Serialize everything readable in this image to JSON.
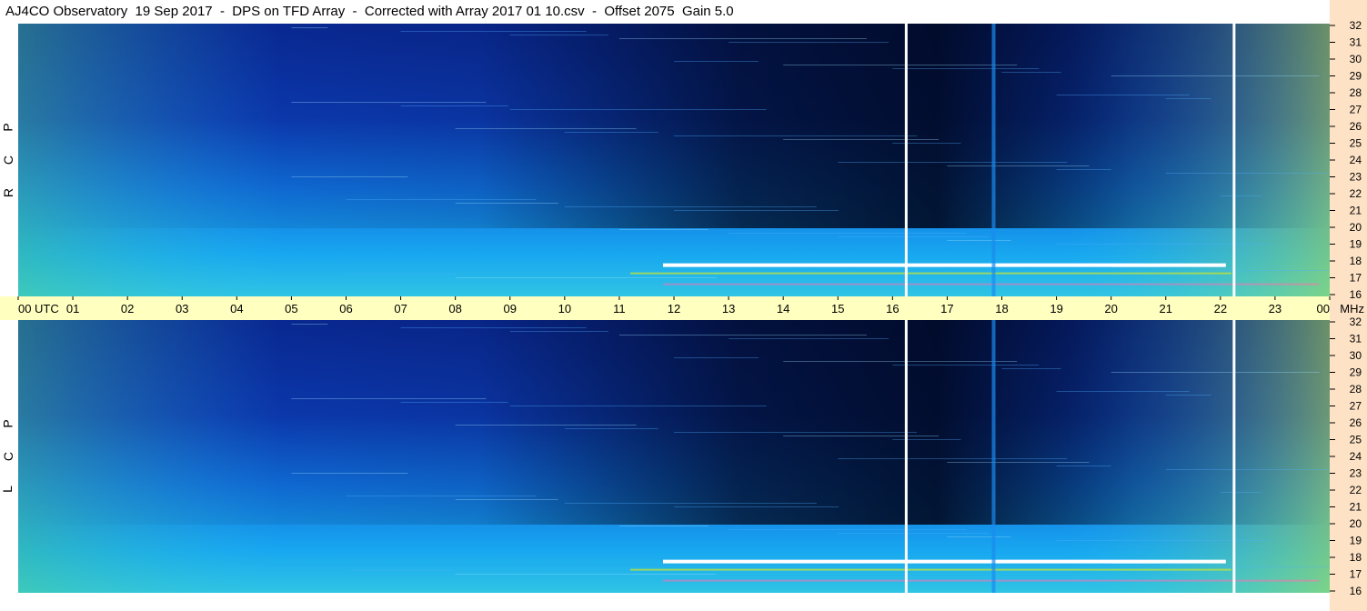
{
  "title": "AJ4CO Observatory  19 Sep 2017  -  DPS on TFD Array  -  Corrected with Array 2017 01 10.csv  -  Offset 2075  Gain 5.0",
  "panels": [
    {
      "polarization_letters": [
        "R",
        "C",
        "P"
      ]
    },
    {
      "polarization_letters": [
        "L",
        "C",
        "P"
      ]
    }
  ],
  "time_axis": {
    "unit_label": "UTC",
    "freq_unit_label": "MHz",
    "ticks": [
      "00",
      "01",
      "02",
      "03",
      "04",
      "05",
      "06",
      "07",
      "08",
      "09",
      "10",
      "11",
      "12",
      "13",
      "14",
      "15",
      "16",
      "17",
      "18",
      "19",
      "20",
      "21",
      "22",
      "23",
      "00"
    ]
  },
  "freq_axis": {
    "ticks": [
      "32",
      "31",
      "30",
      "29",
      "28",
      "27",
      "26",
      "25",
      "24",
      "23",
      "22",
      "21",
      "20",
      "19",
      "18",
      "17",
      "16"
    ]
  },
  "colors": {
    "utc_band": "#ffffc0",
    "mhz_column": "#fde2c6",
    "dark": "#000820",
    "deep_blue": "#0a2a9a",
    "blue": "#0f5ce0",
    "light_blue": "#16a0f0",
    "cyan": "#22c8e8",
    "green_yellow": "#9ee040",
    "white_line": "#ffffff"
  },
  "chart_data": {
    "type": "heatmap",
    "title": "AJ4CO Observatory  19 Sep 2017  -  DPS on TFD Array  -  Corrected with Array 2017 01 10.csv  -  Offset 2075  Gain 5.0",
    "xlabel": "UTC",
    "ylabel": "MHz",
    "xlim": [
      0,
      24
    ],
    "ylim": [
      16,
      32
    ],
    "panels": [
      "RCP",
      "LCP"
    ],
    "time_markers_hours": [
      16.25,
      22.25
    ],
    "carrier_frequency_mhz": 17.75,
    "vertical_stripe_hour": 17.85
  }
}
